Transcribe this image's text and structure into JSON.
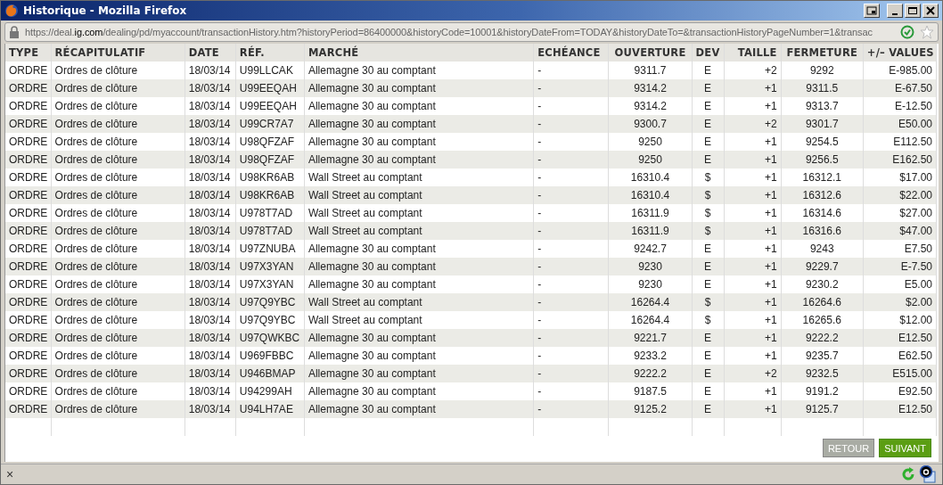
{
  "window": {
    "title": "Historique - Mozilla Firefox"
  },
  "address_bar": {
    "url_prefix": "https://deal.",
    "url_domain": "ig.com",
    "url_rest": "/dealing/pd/myaccount/transactionHistory.htm?historyPeriod=86400000&historyCode=10001&historyDateFrom=TODAY&historyDateTo=&transactionHistoryPageNumber=1&transac"
  },
  "table": {
    "columns": [
      {
        "label": "TYPE"
      },
      {
        "label": "RÉCAPITULATIF"
      },
      {
        "label": "DATE"
      },
      {
        "label": "RÉF."
      },
      {
        "label": "MARCHÉ"
      },
      {
        "label": "ECHÉANCE"
      },
      {
        "label": "OUVERTURE"
      },
      {
        "label": "DEV"
      },
      {
        "label": "TAILLE"
      },
      {
        "label": "FERMETURE"
      },
      {
        "label": "+/– VALUES"
      }
    ],
    "rows": [
      [
        "ORDRE",
        "Ordres de clôture",
        "18/03/14",
        "U99LLCAK",
        "Allemagne 30 au comptant",
        "-",
        "9311.7",
        "E",
        "+2",
        "9292",
        "E-985.00"
      ],
      [
        "ORDRE",
        "Ordres de clôture",
        "18/03/14",
        "U99EEQAH",
        "Allemagne 30 au comptant",
        "-",
        "9314.2",
        "E",
        "+1",
        "9311.5",
        "E-67.50"
      ],
      [
        "ORDRE",
        "Ordres de clôture",
        "18/03/14",
        "U99EEQAH",
        "Allemagne 30 au comptant",
        "-",
        "9314.2",
        "E",
        "+1",
        "9313.7",
        "E-12.50"
      ],
      [
        "ORDRE",
        "Ordres de clôture",
        "18/03/14",
        "U99CR7A7",
        "Allemagne 30 au comptant",
        "-",
        "9300.7",
        "E",
        "+2",
        "9301.7",
        "E50.00"
      ],
      [
        "ORDRE",
        "Ordres de clôture",
        "18/03/14",
        "U98QFZAF",
        "Allemagne 30 au comptant",
        "-",
        "9250",
        "E",
        "+1",
        "9254.5",
        "E112.50"
      ],
      [
        "ORDRE",
        "Ordres de clôture",
        "18/03/14",
        "U98QFZAF",
        "Allemagne 30 au comptant",
        "-",
        "9250",
        "E",
        "+1",
        "9256.5",
        "E162.50"
      ],
      [
        "ORDRE",
        "Ordres de clôture",
        "18/03/14",
        "U98KR6AB",
        "Wall Street au comptant",
        "-",
        "16310.4",
        "$",
        "+1",
        "16312.1",
        "$17.00"
      ],
      [
        "ORDRE",
        "Ordres de clôture",
        "18/03/14",
        "U98KR6AB",
        "Wall Street au comptant",
        "-",
        "16310.4",
        "$",
        "+1",
        "16312.6",
        "$22.00"
      ],
      [
        "ORDRE",
        "Ordres de clôture",
        "18/03/14",
        "U978T7AD",
        "Wall Street au comptant",
        "-",
        "16311.9",
        "$",
        "+1",
        "16314.6",
        "$27.00"
      ],
      [
        "ORDRE",
        "Ordres de clôture",
        "18/03/14",
        "U978T7AD",
        "Wall Street au comptant",
        "-",
        "16311.9",
        "$",
        "+1",
        "16316.6",
        "$47.00"
      ],
      [
        "ORDRE",
        "Ordres de clôture",
        "18/03/14",
        "U97ZNUBA",
        "Allemagne 30 au comptant",
        "-",
        "9242.7",
        "E",
        "+1",
        "9243",
        "E7.50"
      ],
      [
        "ORDRE",
        "Ordres de clôture",
        "18/03/14",
        "U97X3YAN",
        "Allemagne 30 au comptant",
        "-",
        "9230",
        "E",
        "+1",
        "9229.7",
        "E-7.50"
      ],
      [
        "ORDRE",
        "Ordres de clôture",
        "18/03/14",
        "U97X3YAN",
        "Allemagne 30 au comptant",
        "-",
        "9230",
        "E",
        "+1",
        "9230.2",
        "E5.00"
      ],
      [
        "ORDRE",
        "Ordres de clôture",
        "18/03/14",
        "U97Q9YBC",
        "Wall Street au comptant",
        "-",
        "16264.4",
        "$",
        "+1",
        "16264.6",
        "$2.00"
      ],
      [
        "ORDRE",
        "Ordres de clôture",
        "18/03/14",
        "U97Q9YBC",
        "Wall Street au comptant",
        "-",
        "16264.4",
        "$",
        "+1",
        "16265.6",
        "$12.00"
      ],
      [
        "ORDRE",
        "Ordres de clôture",
        "18/03/14",
        "U97QWKBC",
        "Allemagne 30 au comptant",
        "-",
        "9221.7",
        "E",
        "+1",
        "9222.2",
        "E12.50"
      ],
      [
        "ORDRE",
        "Ordres de clôture",
        "18/03/14",
        "U969FBBC",
        "Allemagne 30 au comptant",
        "-",
        "9233.2",
        "E",
        "+1",
        "9235.7",
        "E62.50"
      ],
      [
        "ORDRE",
        "Ordres de clôture",
        "18/03/14",
        "U946BMAP",
        "Allemagne 30 au comptant",
        "-",
        "9222.2",
        "E",
        "+2",
        "9232.5",
        "E515.00"
      ],
      [
        "ORDRE",
        "Ordres de clôture",
        "18/03/14",
        "U94299AH",
        "Allemagne 30 au comptant",
        "-",
        "9187.5",
        "E",
        "+1",
        "9191.2",
        "E92.50"
      ],
      [
        "ORDRE",
        "Ordres de clôture",
        "18/03/14",
        "U94LH7AE",
        "Allemagne 30 au comptant",
        "-",
        "9125.2",
        "E",
        "+1",
        "9125.7",
        "E12.50"
      ]
    ]
  },
  "buttons": [
    {
      "label": "RETOUR",
      "disabled": true
    },
    {
      "label": "SUIVANT",
      "disabled": false
    }
  ],
  "status_bar": {
    "close_label": "×"
  }
}
